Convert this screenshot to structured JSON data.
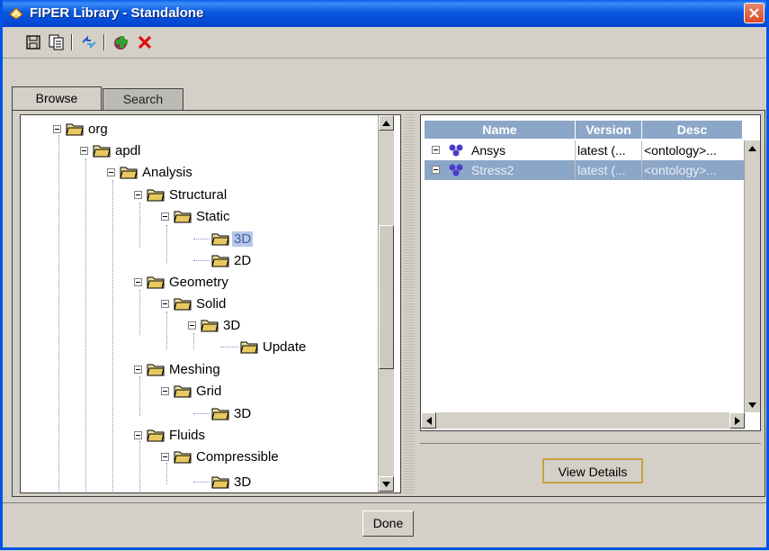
{
  "window": {
    "title": "FIPER Library - Standalone"
  },
  "toolbar": {
    "buttons": [
      {
        "icon": "save-icon"
      },
      {
        "icon": "copy-icon"
      },
      {
        "icon": "refresh-icon"
      },
      {
        "icon": "add-icon"
      },
      {
        "icon": "delete-icon"
      }
    ]
  },
  "tabs": [
    {
      "label": "Browse",
      "active": true
    },
    {
      "label": "Search",
      "active": false
    }
  ],
  "tree": {
    "nodes": [
      {
        "label": "org"
      },
      {
        "label": "apdl"
      },
      {
        "label": "Analysis"
      },
      {
        "label": "Structural"
      },
      {
        "label": "Static"
      },
      {
        "label": "3D",
        "selected": true
      },
      {
        "label": "2D"
      },
      {
        "label": "Geometry"
      },
      {
        "label": "Solid"
      },
      {
        "label": "3D"
      },
      {
        "label": "Update"
      },
      {
        "label": "Meshing"
      },
      {
        "label": "Grid"
      },
      {
        "label": "3D"
      },
      {
        "label": "Fluids"
      },
      {
        "label": "Compressible"
      },
      {
        "label": "3D"
      }
    ]
  },
  "table": {
    "columns": [
      "Name",
      "Version",
      "Desc"
    ],
    "rows": [
      {
        "name": "Ansys",
        "version": "latest (...",
        "desc": "<ontology>...",
        "selected": false
      },
      {
        "name": "Stress2",
        "version": "latest (...",
        "desc": "<ontology>...",
        "selected": true
      }
    ]
  },
  "buttons": {
    "view_details": "View Details",
    "done": "Done"
  },
  "colors": {
    "titlebar": "#0054e3",
    "selection": "#8ca6c8",
    "close": "#d94a26"
  }
}
